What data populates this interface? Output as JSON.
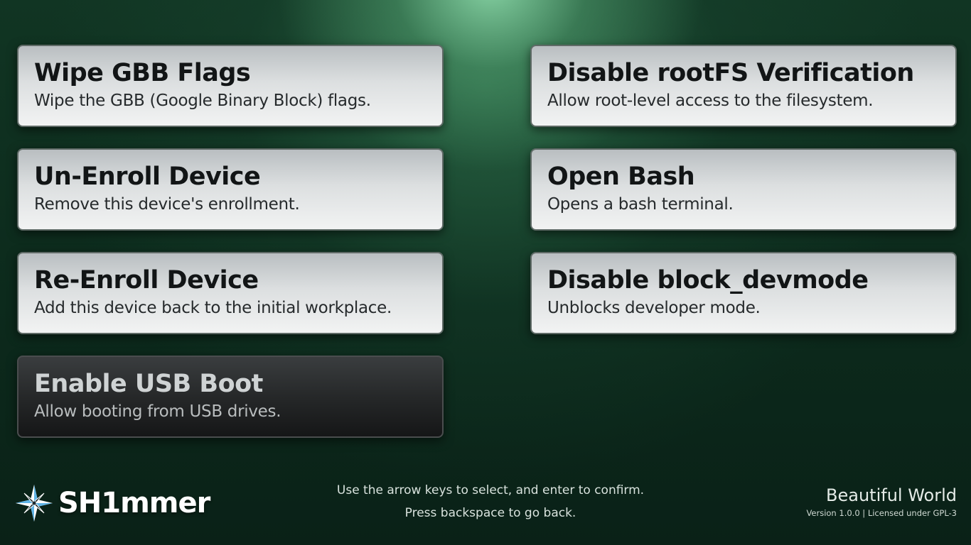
{
  "menu": {
    "items": [
      {
        "title": "Wipe GBB Flags",
        "description": "Wipe the GBB (Google Binary Block) flags.",
        "selected": false
      },
      {
        "title": "Disable rootFS Verification",
        "description": "Allow root-level access to the filesystem.",
        "selected": false
      },
      {
        "title": "Un-Enroll Device",
        "description": "Remove this device's enrollment.",
        "selected": false
      },
      {
        "title": "Open Bash",
        "description": "Opens a bash terminal.",
        "selected": false
      },
      {
        "title": "Re-Enroll Device",
        "description": "Add this device back to the initial workplace.",
        "selected": false
      },
      {
        "title": "Disable block_devmode",
        "description": "Unblocks developer mode.",
        "selected": false
      },
      {
        "title": "Enable USB Boot",
        "description": "Allow booting from USB drives.",
        "selected": true
      }
    ]
  },
  "footer": {
    "logo_text": "SH1mmer",
    "logo_icon": "compass-star-icon",
    "hint_line1": "Use the arrow keys to select, and enter to confirm.",
    "hint_line2": "Press backspace to go back.",
    "theme_name": "Beautiful World",
    "version_text": "Version 1.0.0 | Licensed under GPL-3"
  },
  "colors": {
    "background": "#0c2a1c",
    "spotlight": "#96e6b4",
    "card_light": "#e6e8e9",
    "card_selected": "#262829"
  }
}
